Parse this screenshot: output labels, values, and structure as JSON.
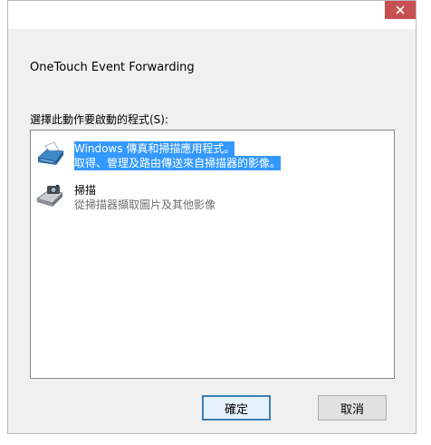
{
  "dialog": {
    "title": "OneTouch Event Forwarding",
    "list_label": "選擇此動作要啟動的程式(S):",
    "colors": {
      "close": "#c75050",
      "selection": "#3399ff",
      "primary_border": "#3c7fb1"
    }
  },
  "programs": [
    {
      "icon": "fax-scan-icon",
      "name": "Windows 傳真和掃描應用程式。",
      "description": "取得、管理及路由傳送來自掃描器的影像。",
      "selected": true
    },
    {
      "icon": "scanner-camera-icon",
      "name": "掃描",
      "description": "從掃描器擷取圖片及其他影像",
      "selected": false
    }
  ],
  "buttons": {
    "ok": "確定",
    "cancel": "取消"
  }
}
